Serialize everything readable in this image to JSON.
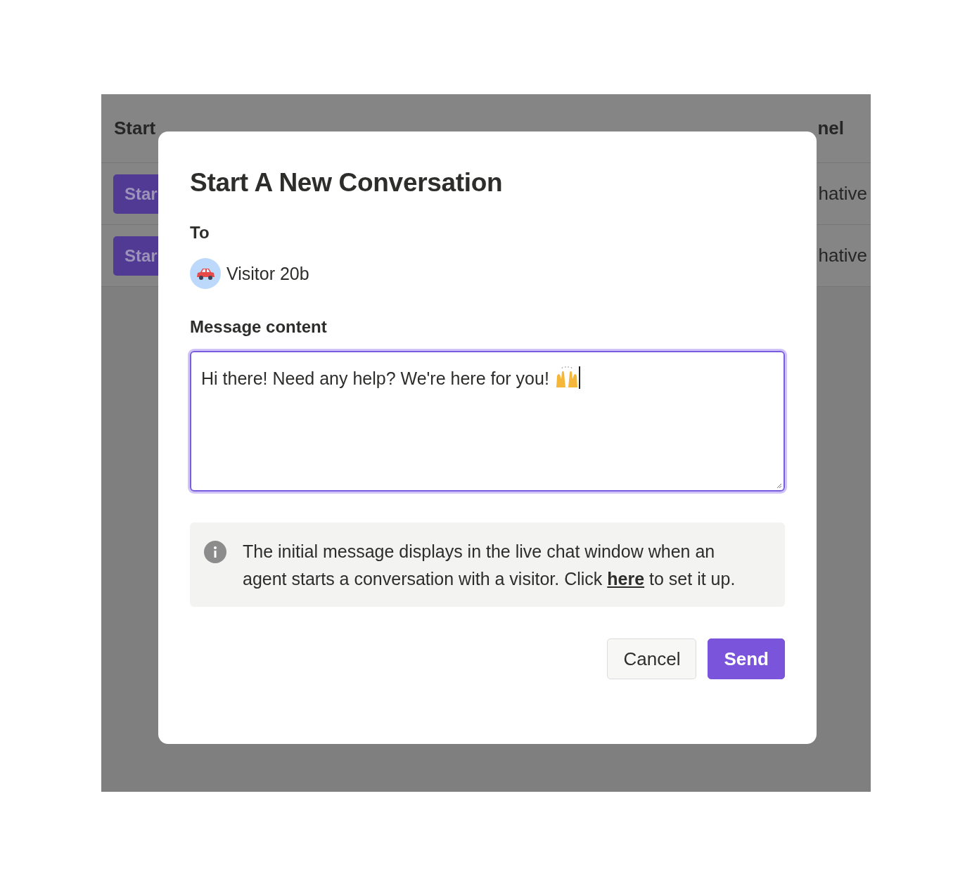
{
  "background_table": {
    "header": [
      "Start",
      "nel"
    ],
    "rows": [
      {
        "button": "Star",
        "last_cell": "hative"
      },
      {
        "button": "Star",
        "last_cell": "hative"
      }
    ]
  },
  "dialog": {
    "title": "Start A New Conversation",
    "to_label": "To",
    "recipient": {
      "name": "Visitor 20b"
    },
    "message_label": "Message content",
    "message": {
      "value": "Hi there! Need any help? We're here for you!",
      "focused": true
    },
    "info": {
      "before": "The initial message displays in the live chat window when an agent starts a conversation with a visitor. Click ",
      "link": "here",
      "after": " to set it up."
    },
    "buttons": [
      {
        "label": "Cancel",
        "kind": "secondary"
      },
      {
        "label": "Send",
        "kind": "primary"
      }
    ]
  }
}
